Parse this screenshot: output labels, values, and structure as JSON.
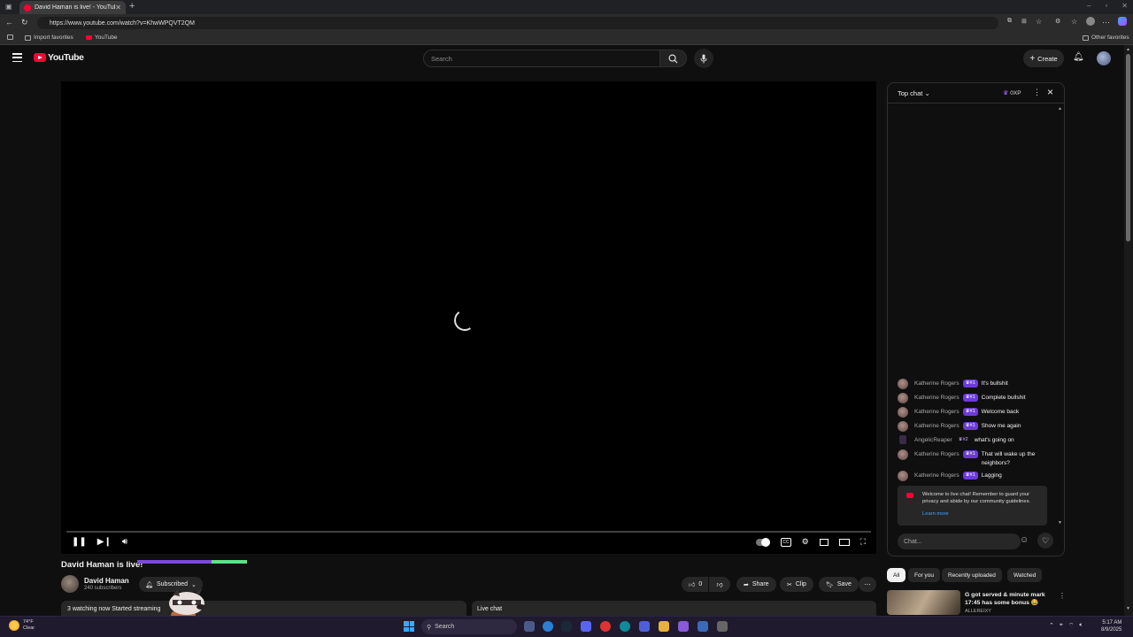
{
  "browser": {
    "tab_title": "David Haman is live! - YouTube",
    "url": "https://www.youtube.com/watch?v=KhwWPQVT2QM",
    "bookmarks": [
      "Import favorites",
      "YouTube"
    ],
    "other_favorites": "Other favorites"
  },
  "header": {
    "logo_text": "YouTube",
    "search_placeholder": "Search",
    "create_label": "Create"
  },
  "player": {
    "state": "loading",
    "progress": 0
  },
  "video": {
    "title": "David Haman is live!",
    "channel_name": "David Haman",
    "subscribers": "240 subscribers",
    "subscribed_label": "Subscribed",
    "like_count": "0",
    "share_label": "Share",
    "clip_label": "Clip",
    "save_label": "Save",
    "meta": "3 watching now  Started streaming",
    "live_chat_label": "Live chat"
  },
  "chat": {
    "mode_label": "Top chat",
    "xp_label": "0XP",
    "messages": [
      {
        "author": "Katherine Rogers",
        "badge": "#1",
        "text": "It's bullshit"
      },
      {
        "author": "Katherine Rogers",
        "badge": "#1",
        "text": "Complete bullshit"
      },
      {
        "author": "Katherine Rogers",
        "badge": "#1",
        "text": "Welcome back"
      },
      {
        "author": "Katherine Rogers",
        "badge": "#1",
        "text": "Show me again"
      },
      {
        "author": "AngelicReaper",
        "badge": "#2",
        "text": "what's going on"
      },
      {
        "author": "Katherine Rogers",
        "badge": "#1",
        "text": "That will wake up the neighbors?"
      },
      {
        "author": "Katherine Rogers",
        "badge": "#1",
        "text": "Lagging"
      }
    ],
    "welcome_text": "Welcome to live chat! Remember to guard your privacy and abide by our community guidelines.",
    "learn_more": "Learn more",
    "input_placeholder": "Chat..."
  },
  "recommendations": {
    "chips": [
      "All",
      "For you",
      "Recently uploaded",
      "Watched"
    ],
    "active_chip": "All",
    "first_title": "G got served & minute mark 17:45 has some bonus 😂",
    "first_channel": "ALLEREIXY"
  },
  "taskbar": {
    "temperature": "74°F",
    "condition": "Clear",
    "search_label": "Search",
    "time": "5:17 AM",
    "date": "8/9/2025"
  },
  "colors": {
    "yt_red": "#ff0033",
    "badge_purple": "#6d3bd8",
    "link_blue": "#3ea6ff",
    "background": "#0f0f0f"
  }
}
